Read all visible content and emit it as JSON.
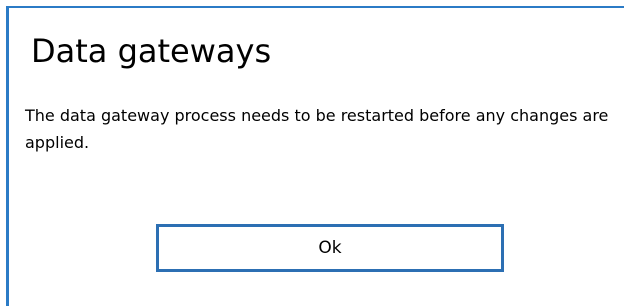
{
  "dialog": {
    "title": "Data gateways",
    "message": "The data gateway process needs to be restarted before any changes are applied.",
    "ok_label": "Ok"
  },
  "colors": {
    "accent": "#2b7bc6",
    "button_border": "#2c6fb3"
  }
}
